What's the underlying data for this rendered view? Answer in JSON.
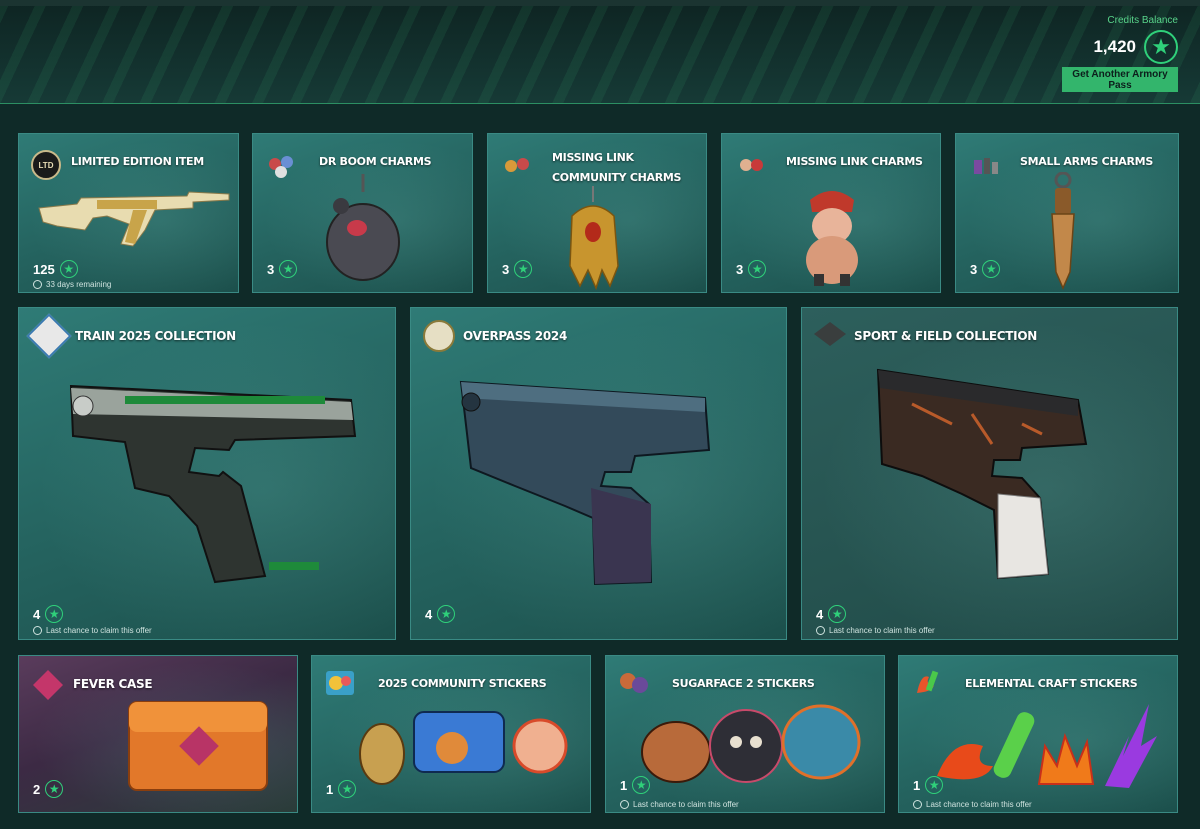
{
  "header": {
    "credits_label": "Credits Balance",
    "credits_value": "1,420",
    "pass_button": "Get Another Armory Pass"
  },
  "cards": {
    "limited": {
      "title": "LIMITED EDITION ITEM",
      "price": "125",
      "note": "33 days remaining",
      "icon_text": "LTD"
    },
    "dr_boom": {
      "title": "DR BOOM CHARMS",
      "price": "3"
    },
    "missing_link_community": {
      "title": "MISSING LINK COMMUNITY CHARMS",
      "price": "3"
    },
    "missing_link": {
      "title": "MISSING LINK CHARMS",
      "price": "3"
    },
    "small_arms": {
      "title": "SMALL ARMS CHARMS",
      "price": "3"
    },
    "train": {
      "title": "TRAIN 2025 COLLECTION",
      "price": "4",
      "note": "Last chance to claim this offer"
    },
    "overpass": {
      "title": "OVERPASS 2024",
      "price": "4"
    },
    "sport": {
      "title": "SPORT & FIELD COLLECTION",
      "price": "4",
      "note": "Last chance to claim this offer"
    },
    "fever": {
      "title": "FEVER CASE",
      "price": "2"
    },
    "community_stickers": {
      "title": "2025 COMMUNITY STICKERS",
      "price": "1"
    },
    "sugarface": {
      "title": "SUGARFACE 2 STICKERS",
      "price": "1",
      "note": "Last chance to claim this offer"
    },
    "elemental": {
      "title": "ELEMENTAL CRAFT STICKERS",
      "price": "1",
      "note": "Last chance to claim this offer"
    }
  },
  "icons": {
    "star": "★",
    "currency_icon": "star-coin-icon",
    "clock_icon": "clock-icon"
  },
  "colors": {
    "accent": "#33b56c",
    "star": "#2fd07a",
    "card_teal": "#2f7b76"
  }
}
